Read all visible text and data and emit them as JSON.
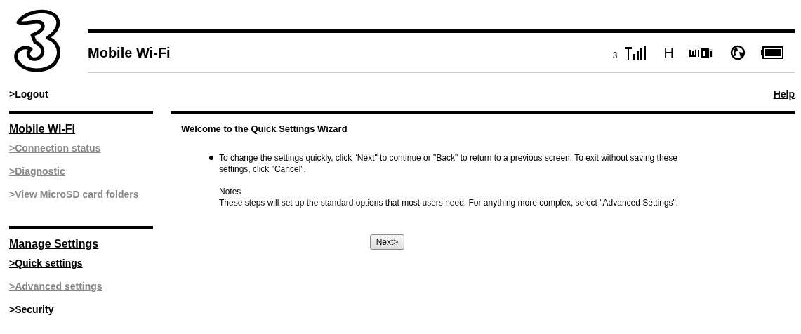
{
  "header": {
    "title": "Mobile Wi-Fi",
    "operator": "3",
    "network_type": "H"
  },
  "logout": ">Logout",
  "help": "Help",
  "sidebar": [
    {
      "heading": "Mobile Wi-Fi",
      "items": [
        {
          "label": ">Connection status",
          "disabled": true
        },
        {
          "label": ">Diagnostic",
          "disabled": true
        },
        {
          "label": ">View MicroSD card folders",
          "disabled": true
        }
      ]
    },
    {
      "heading": "Manage Settings",
      "items": [
        {
          "label": ">Quick settings",
          "disabled": false
        },
        {
          "label": ">Advanced settings",
          "disabled": true
        },
        {
          "label": ">Security",
          "disabled": false
        }
      ]
    }
  ],
  "main": {
    "title": "Welcome to the Quick Settings Wizard",
    "bullet": "To change the settings quickly, click \"Next\" to continue or \"Back\" to return to a previous screen. To exit without saving these settings, click \"Cancel\".",
    "notes_title": "Notes",
    "notes": "These steps will set up the standard options that most users need. For anything more complex, select \"Advanced Settings\".",
    "button": "Next>"
  }
}
